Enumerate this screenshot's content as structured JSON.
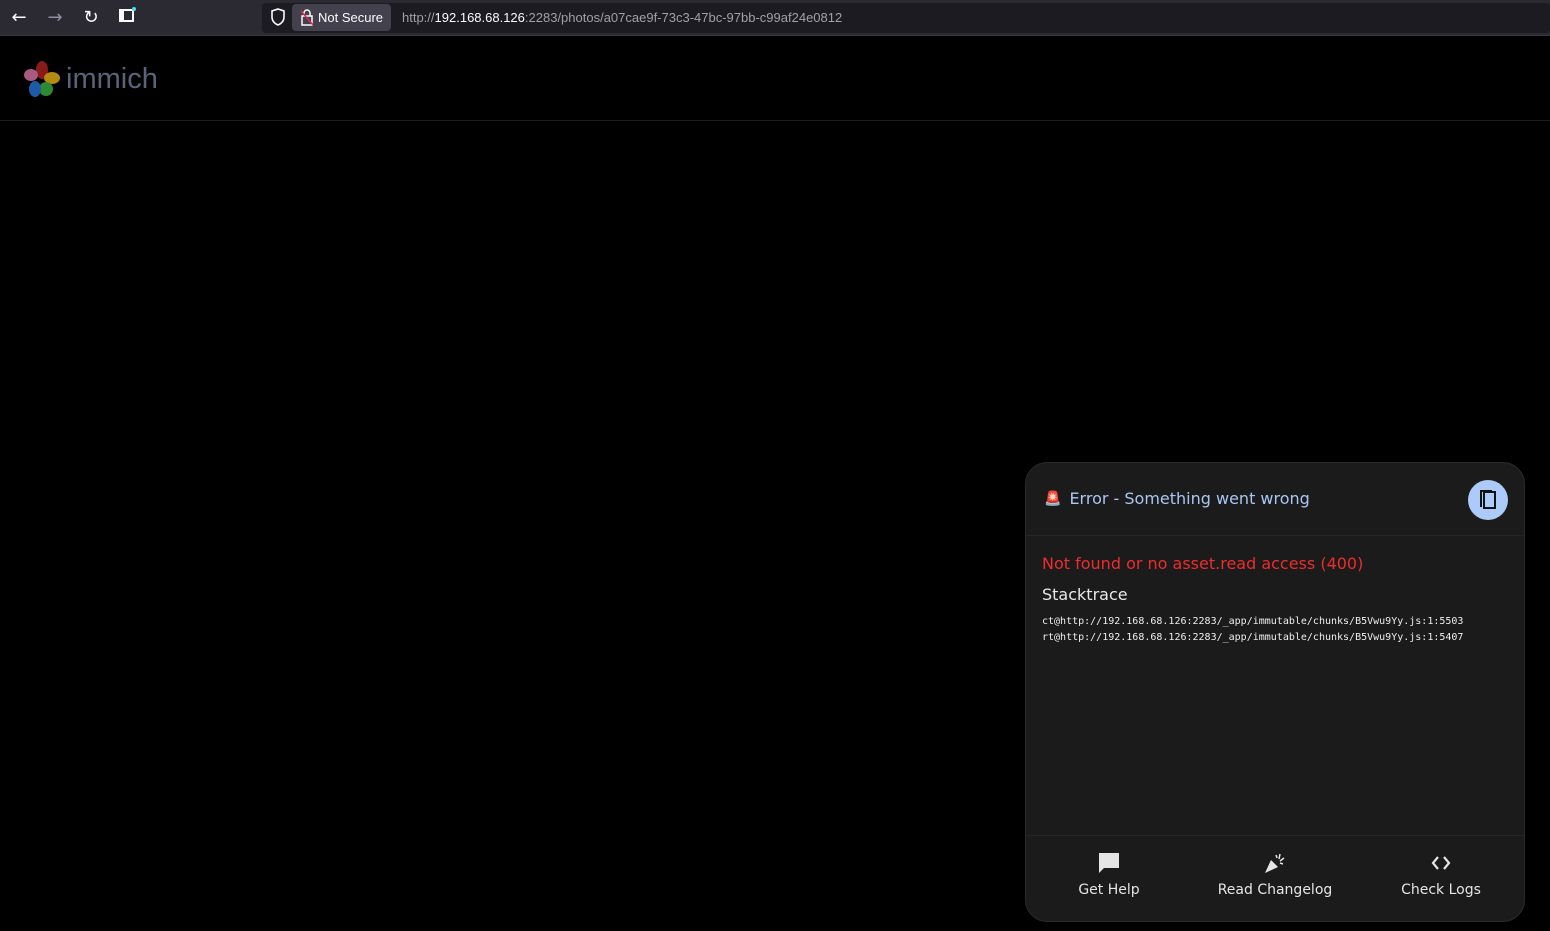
{
  "browser": {
    "security_label": "Not Secure",
    "url_prefix": "http://",
    "url_host": "192.168.68.126",
    "url_rest": ":2283/photos/a07cae9f-73c3-47bc-97bb-c99af24e0812"
  },
  "app": {
    "logo_text": "immich"
  },
  "error_panel": {
    "title": "Error - Something went wrong",
    "message": "Not found or no asset.read access (400)",
    "stacktrace_heading": "Stacktrace",
    "stacktrace": [
      "ct@http://192.168.68.126:2283/_app/immutable/chunks/B5Vwu9Yy.js:1:5503",
      "rt@http://192.168.68.126:2283/_app/immutable/chunks/B5Vwu9Yy.js:1:5407"
    ],
    "actions": [
      {
        "label": "Get Help",
        "icon": "message-icon"
      },
      {
        "label": "Read Changelog",
        "icon": "party-popper-icon"
      },
      {
        "label": "Check Logs",
        "icon": "code-icon"
      }
    ]
  },
  "colors": {
    "accent": "#adcbfa",
    "error": "#ee2c2c"
  }
}
